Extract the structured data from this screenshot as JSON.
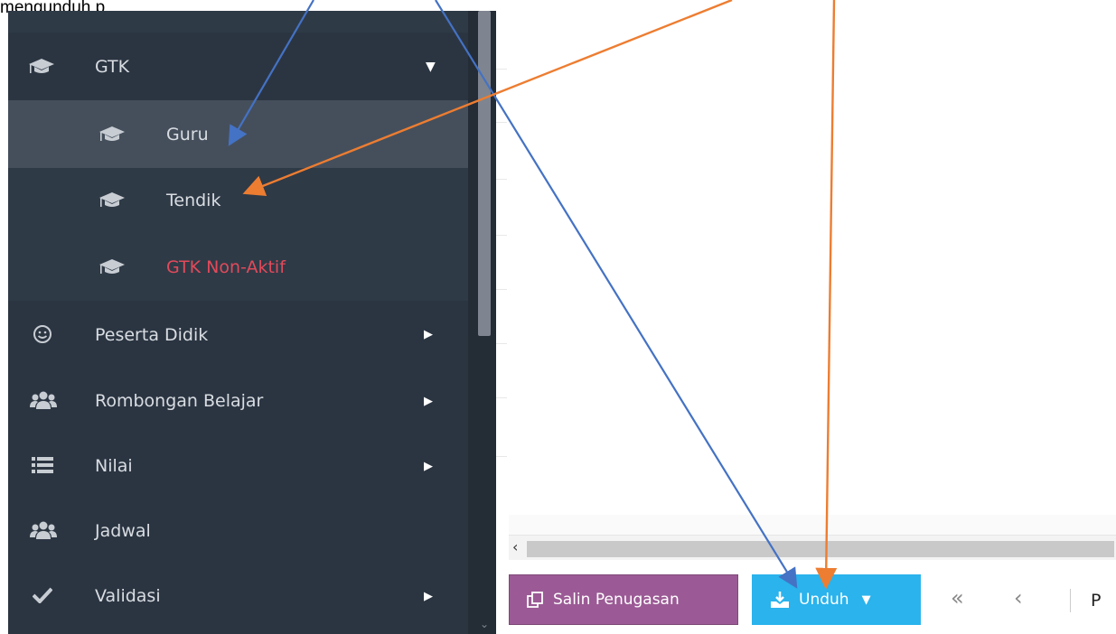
{
  "caption": "mengunduh p",
  "sidebar": {
    "gtk": {
      "label": "GTK",
      "icon": "graduation-cap-icon"
    },
    "sub_items": [
      {
        "label": "Guru",
        "icon": "graduation-cap-icon",
        "active": true
      },
      {
        "label": "Tendik",
        "icon": "graduation-cap-icon"
      },
      {
        "label": "GTK Non-Aktif",
        "icon": "graduation-cap-icon",
        "color": "#e24a5a"
      }
    ],
    "items": [
      {
        "label": "Peserta Didik",
        "icon": "smile-icon",
        "has_arrow": true
      },
      {
        "label": "Rombongan Belajar",
        "icon": "users-icon",
        "has_arrow": true
      },
      {
        "label": "Nilai",
        "icon": "list-icon",
        "has_arrow": true
      },
      {
        "label": "Jadwal",
        "icon": "users-icon",
        "has_arrow": false
      },
      {
        "label": "Validasi",
        "icon": "check-icon",
        "has_arrow": true
      }
    ]
  },
  "toolbar": {
    "salin_label": "Salin Penugasan",
    "unduh_label": "Unduh",
    "pager_text": "P"
  },
  "colors": {
    "sidebar_bg": "#2b3542",
    "active_bg": "#454f5c",
    "accent_blue": "#2ab3ec",
    "accent_purple": "#9b5a95",
    "arrow_blue": "#4472c4",
    "arrow_orange": "#ed7d31"
  }
}
